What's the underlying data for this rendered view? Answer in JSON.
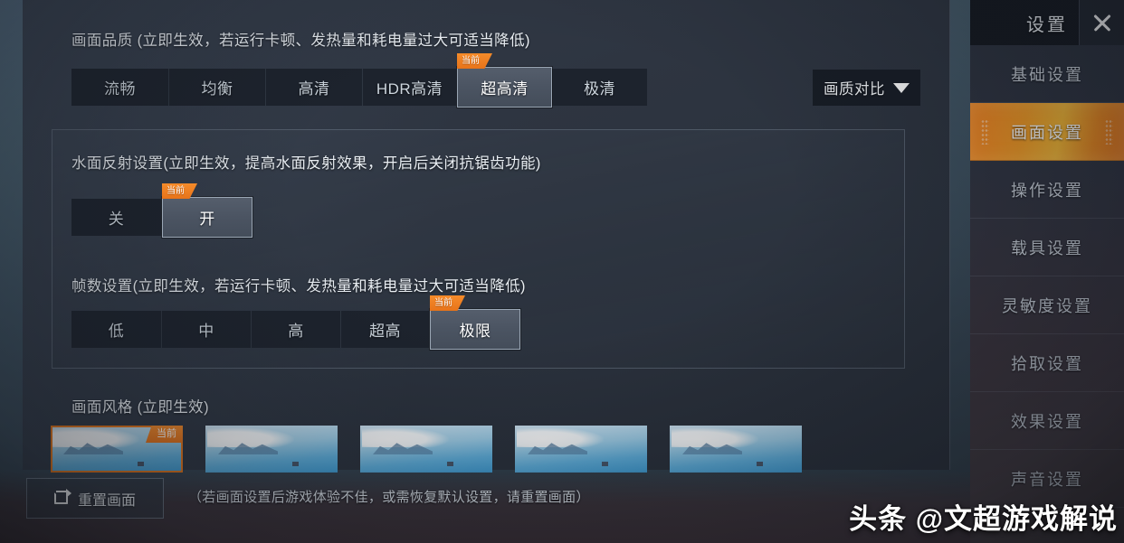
{
  "panel": {
    "quality": {
      "title": "画面品质 (立即生效，若运行卡顿、发热量和耗电量过大可适当降低)",
      "options": [
        "流畅",
        "均衡",
        "高清",
        "HDR高清",
        "超高清",
        "极清"
      ],
      "selected_index": 4,
      "badge_label": "当前",
      "compare_button": "画质对比",
      "compare_icon": "chevron-down-icon"
    },
    "water_reflection": {
      "title": "水面反射设置(立即生效，提高水面反射效果，开启后关闭抗锯齿功能)",
      "options": [
        "关",
        "开"
      ],
      "selected_index": 1,
      "badge_label": "当前"
    },
    "frame_rate": {
      "title": "帧数设置(立即生效，若运行卡顿、发热量和耗电量过大可适当降低)",
      "options": [
        "低",
        "中",
        "高",
        "超高",
        "极限"
      ],
      "selected_index": 4,
      "badge_label": "当前"
    },
    "screen_style": {
      "title": "画面风格 (立即生效)",
      "thumbnail_count": 5,
      "selected_index": 0,
      "badge_label": "当前"
    }
  },
  "bottom": {
    "reset_label": "重置画面",
    "reset_icon": "reset-icon",
    "hint": "（若画面设置后游戏体验不佳，或需恢复默认设置，请重置画面）"
  },
  "sidebar": {
    "title": "设置",
    "close_icon": "close-icon",
    "items": [
      {
        "label": "基础设置",
        "active": false
      },
      {
        "label": "画面设置",
        "active": true
      },
      {
        "label": "操作设置",
        "active": false
      },
      {
        "label": "载具设置",
        "active": false
      },
      {
        "label": "灵敏度设置",
        "active": false
      },
      {
        "label": "拾取设置",
        "active": false
      },
      {
        "label": "效果设置",
        "active": false
      },
      {
        "label": "声音设置",
        "active": false
      }
    ]
  },
  "watermark": {
    "text": "头条 @文超游戏解说"
  },
  "colors": {
    "accent_orange": "#e8741a",
    "panel_bg": "#2e3541",
    "button_bg": "#1d232d",
    "selected_button_bg": "#4b5462",
    "sidebar_bg": "#2b313d",
    "text_primary": "#e9eef3"
  }
}
